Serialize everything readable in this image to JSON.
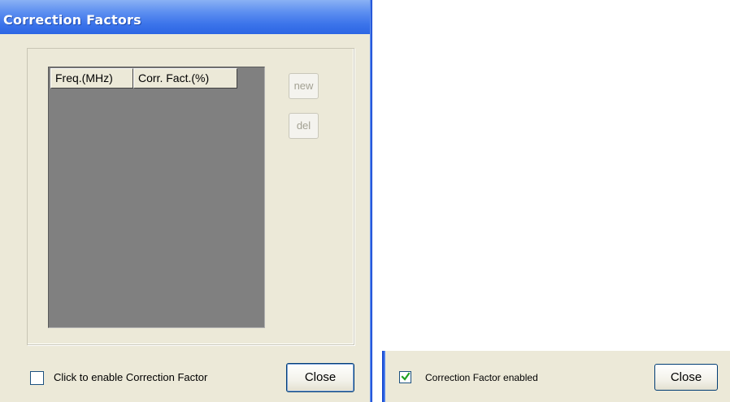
{
  "dialog": {
    "title": "Correction Factors",
    "table": {
      "columns": [
        "Freq.(MHz)",
        "Corr. Fact.(%)"
      ],
      "rows": []
    },
    "buttons": {
      "new_label": "new",
      "del_label": "del",
      "close_label": "Close"
    },
    "checkbox": {
      "label": "Click to enable Correction Factor",
      "checked": false
    }
  },
  "enabled_panel": {
    "checkbox": {
      "label": "Correction Factor enabled",
      "checked": true
    },
    "close_label": "Close"
  },
  "colors": {
    "title_bar": "#3c74ea",
    "dialog_bg": "#ece9d8",
    "table_bg": "#808080",
    "check_mark": "#21a121"
  }
}
